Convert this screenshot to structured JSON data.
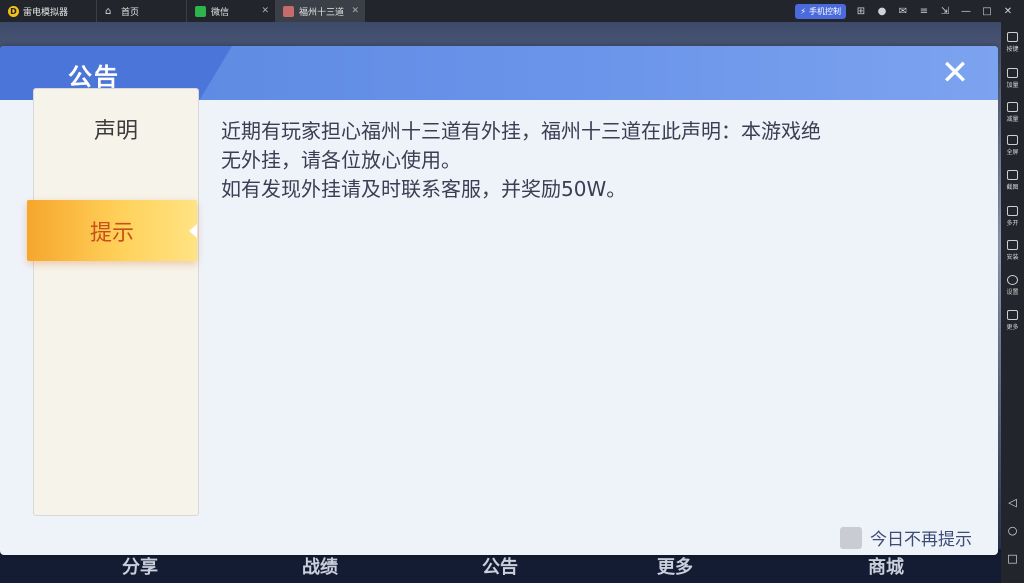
{
  "titlebar": {
    "app_name": "雷电模拟器",
    "tabs": [
      {
        "label": "首页",
        "icon": "home-icon"
      },
      {
        "label": "微信",
        "icon": "wechat-icon"
      },
      {
        "label": "福州十三道",
        "icon": "game-icon"
      }
    ],
    "phone_control_label": "手机控制"
  },
  "sidebar": {
    "items": [
      {
        "label": "按键",
        "icon": "keyboard-icon"
      },
      {
        "label": "加量",
        "icon": "volume-up-icon"
      },
      {
        "label": "减量",
        "icon": "volume-down-icon"
      },
      {
        "label": "全屏",
        "icon": "fullscreen-icon"
      },
      {
        "label": "截图",
        "icon": "scissors-icon"
      },
      {
        "label": "多开",
        "icon": "multi-instance-icon"
      },
      {
        "label": "安装",
        "icon": "install-icon"
      },
      {
        "label": "设置",
        "icon": "settings-icon"
      },
      {
        "label": "更多",
        "icon": "more-icon"
      }
    ]
  },
  "game_bottom": {
    "items": [
      "分享",
      "战绩",
      "公告",
      "更多",
      "商城"
    ]
  },
  "dialog": {
    "title": "公告",
    "menu": [
      {
        "label": "声明",
        "selected": false
      },
      {
        "label": "提示",
        "selected": true
      }
    ],
    "content_lines": [
      "近期有玩家担心福州十三道有外挂，福州十三道在此声明：本游戏绝",
      "无外挂，请各位放心使用。",
      "如有发现外挂请及时联系客服，并奖励50W。"
    ],
    "dont_show_label": "今日不再提示"
  },
  "colors": {
    "header": "#5a86e0",
    "selected_tab": "#f6a62c",
    "selected_text": "#c7501d"
  }
}
